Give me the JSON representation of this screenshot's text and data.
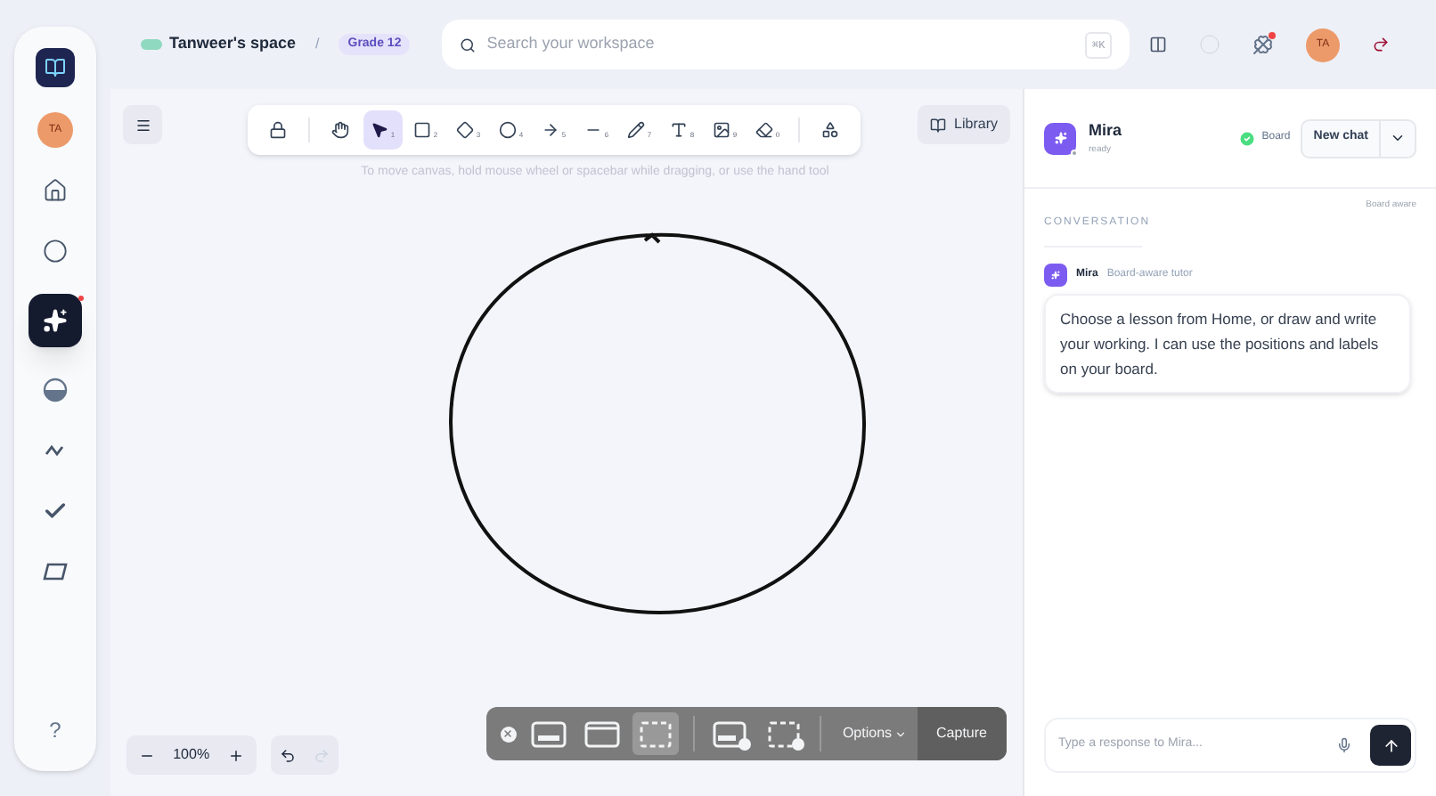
{
  "header": {
    "space": "Tanweer's space",
    "separator": "/",
    "grade": "Grade 12",
    "search": {
      "placeholder": "Search your workspace",
      "shortcut": "⌘K"
    },
    "avatar": "TA",
    "notification": true
  },
  "sidebar": {
    "avatar": "TA",
    "items": [
      {
        "kind": "home",
        "selected": false
      },
      {
        "kind": "circle",
        "selected": false
      },
      {
        "kind": "sparkle",
        "selected": true,
        "badge": true
      },
      {
        "kind": "half",
        "selected": false
      },
      {
        "kind": "squiggle",
        "selected": false
      },
      {
        "kind": "check",
        "selected": false
      },
      {
        "kind": "parallelogram",
        "selected": false
      }
    ],
    "help": "?"
  },
  "toolbar": {
    "tools": [
      {
        "kind": "lock",
        "selected": false
      },
      {
        "kind": "hand",
        "selected": false
      },
      {
        "kind": "select",
        "key": "1",
        "selected": true
      },
      {
        "kind": "rect",
        "key": "2",
        "selected": false
      },
      {
        "kind": "diamond",
        "key": "3",
        "selected": false
      },
      {
        "kind": "ellipse",
        "key": "4",
        "selected": false
      },
      {
        "kind": "arrow",
        "key": "5",
        "selected": false
      },
      {
        "kind": "line",
        "key": "6",
        "selected": false
      },
      {
        "kind": "pencil",
        "key": "7",
        "selected": false
      },
      {
        "kind": "text",
        "key": "8",
        "selected": false
      },
      {
        "kind": "image",
        "key": "9",
        "selected": false
      },
      {
        "kind": "eraser",
        "key": "0",
        "selected": false
      },
      {
        "kind": "shapes",
        "selected": false
      }
    ],
    "library": "Library",
    "hint": "To move canvas, hold mouse wheel or spacebar while dragging, or use the hand tool"
  },
  "zoom": {
    "value": "100%"
  },
  "capture_bar": {
    "modes": [
      {
        "kind": "full",
        "selected": false
      },
      {
        "kind": "window",
        "selected": false
      },
      {
        "kind": "selection",
        "selected": true
      },
      {
        "kind": "record-full",
        "selected": false
      },
      {
        "kind": "record-selection",
        "selected": false
      }
    ],
    "options": "Options",
    "capture": "Capture"
  },
  "chat": {
    "name": "Mira",
    "status": "ready",
    "board": "Board",
    "new_chat": "New chat",
    "board_aware": "Board aware",
    "section": "CONVERSATION",
    "messages": [
      {
        "sender": "Mira",
        "role": "Board-aware tutor",
        "text": "Choose a lesson from Home, or draw and write your working. I can use the positions and labels on your board."
      }
    ],
    "input": {
      "placeholder": "Type a response to Mira..."
    }
  }
}
